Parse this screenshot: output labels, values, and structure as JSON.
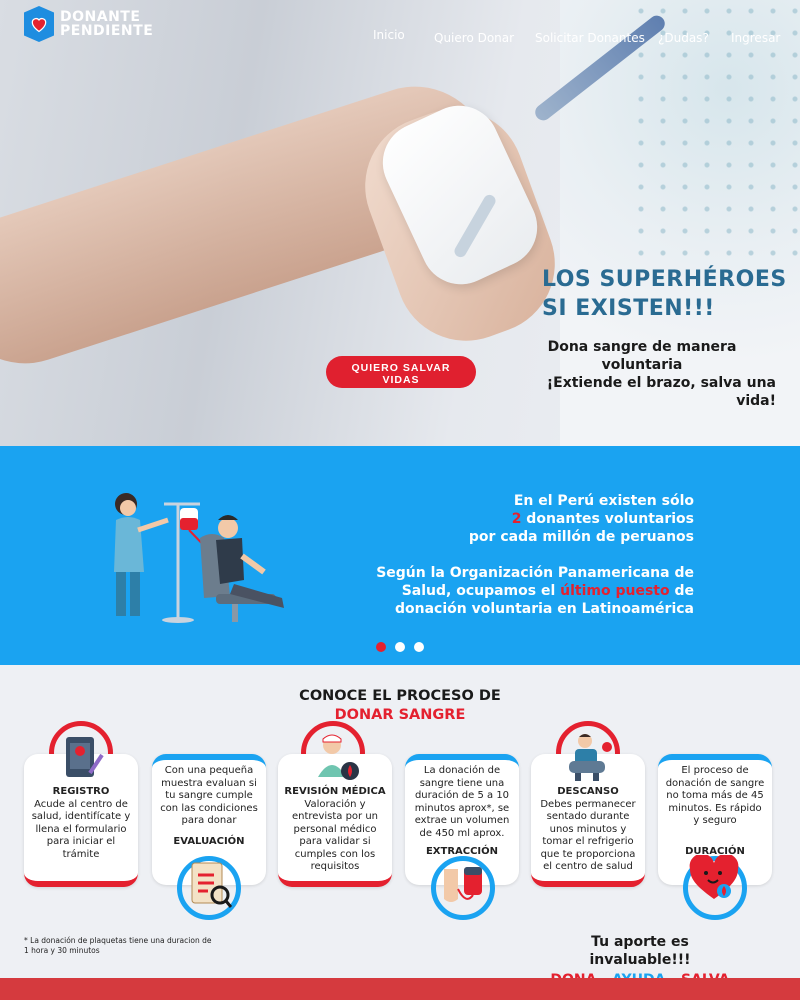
{
  "brand": {
    "line1": "DONANTE",
    "line2": "PENDIENTE"
  },
  "nav": [
    "Inicio",
    "Quiero Donar",
    "Solicitar Donantes",
    "¿Dudas?",
    "Ingresar"
  ],
  "hero": {
    "title_line1": "LOS SUPERHÉROES",
    "title_line2": "SI EXISTEN!!!",
    "sub_line1": "Dona sangre de manera",
    "sub_line2": "voluntaria",
    "sub_line3": "¡Extiende el brazo, salva una vida!",
    "cta_line1": "QUIERO SALVAR",
    "cta_line2": "VIDAS"
  },
  "stats": {
    "p1_line1": "En el Perú existen sólo",
    "p1_num": "2",
    "p1_line2": " donantes voluntarios",
    "p1_line3": "por cada millón de peruanos",
    "p2_line1": "Según la Organización Panamericana de",
    "p2_line2a": "Salud, ocupamos el ",
    "p2_highlight": "último puesto",
    "p2_line2b": " de",
    "p2_line3": "donación voluntaria en Latinoamérica",
    "active_slide": 1,
    "slides": 3
  },
  "process": {
    "title1": "CONOCE EL PROCESO DE",
    "title2": "DONAR SANGRE",
    "steps": [
      {
        "title": "REGISTRO",
        "text": "Acude al centro de salud, identifícate y llena el formulario para iniciar el trámite"
      },
      {
        "title": "EVALUACIÓN",
        "text": "Con una pequeña muestra evaluan si tu sangre cumple con las condiciones para donar"
      },
      {
        "title": "REVISIÓN MÉDICA",
        "text": "Valoración y entrevista por un personal médico para validar si cumples con los requisitos"
      },
      {
        "title": "EXTRACCIÓN",
        "text": "La donación de sangre tiene una duración de 5 a 10 minutos aprox*, se extrae un volumen de 450 ml aprox."
      },
      {
        "title": "DESCANSO",
        "text": "Debes permanecer sentado durante unos minutos y tomar el refrigerio que te proporciona el centro de salud"
      },
      {
        "title": "DURACIÓN",
        "text": "El proceso de donación de sangre no toma más de 45 minutos. Es rápido y seguro"
      }
    ],
    "footnote": "* La donación de plaquetas tiene una duracion de 1 hora y 30 minutos",
    "tagline": "Tu aporte es invaluable!!!",
    "words": [
      "DONA",
      "AYUDA",
      "SALVA"
    ],
    "sep": "-"
  },
  "colors": {
    "red": "#e4212f",
    "blue": "#1aa3f1",
    "navy": "#2a6b92"
  }
}
